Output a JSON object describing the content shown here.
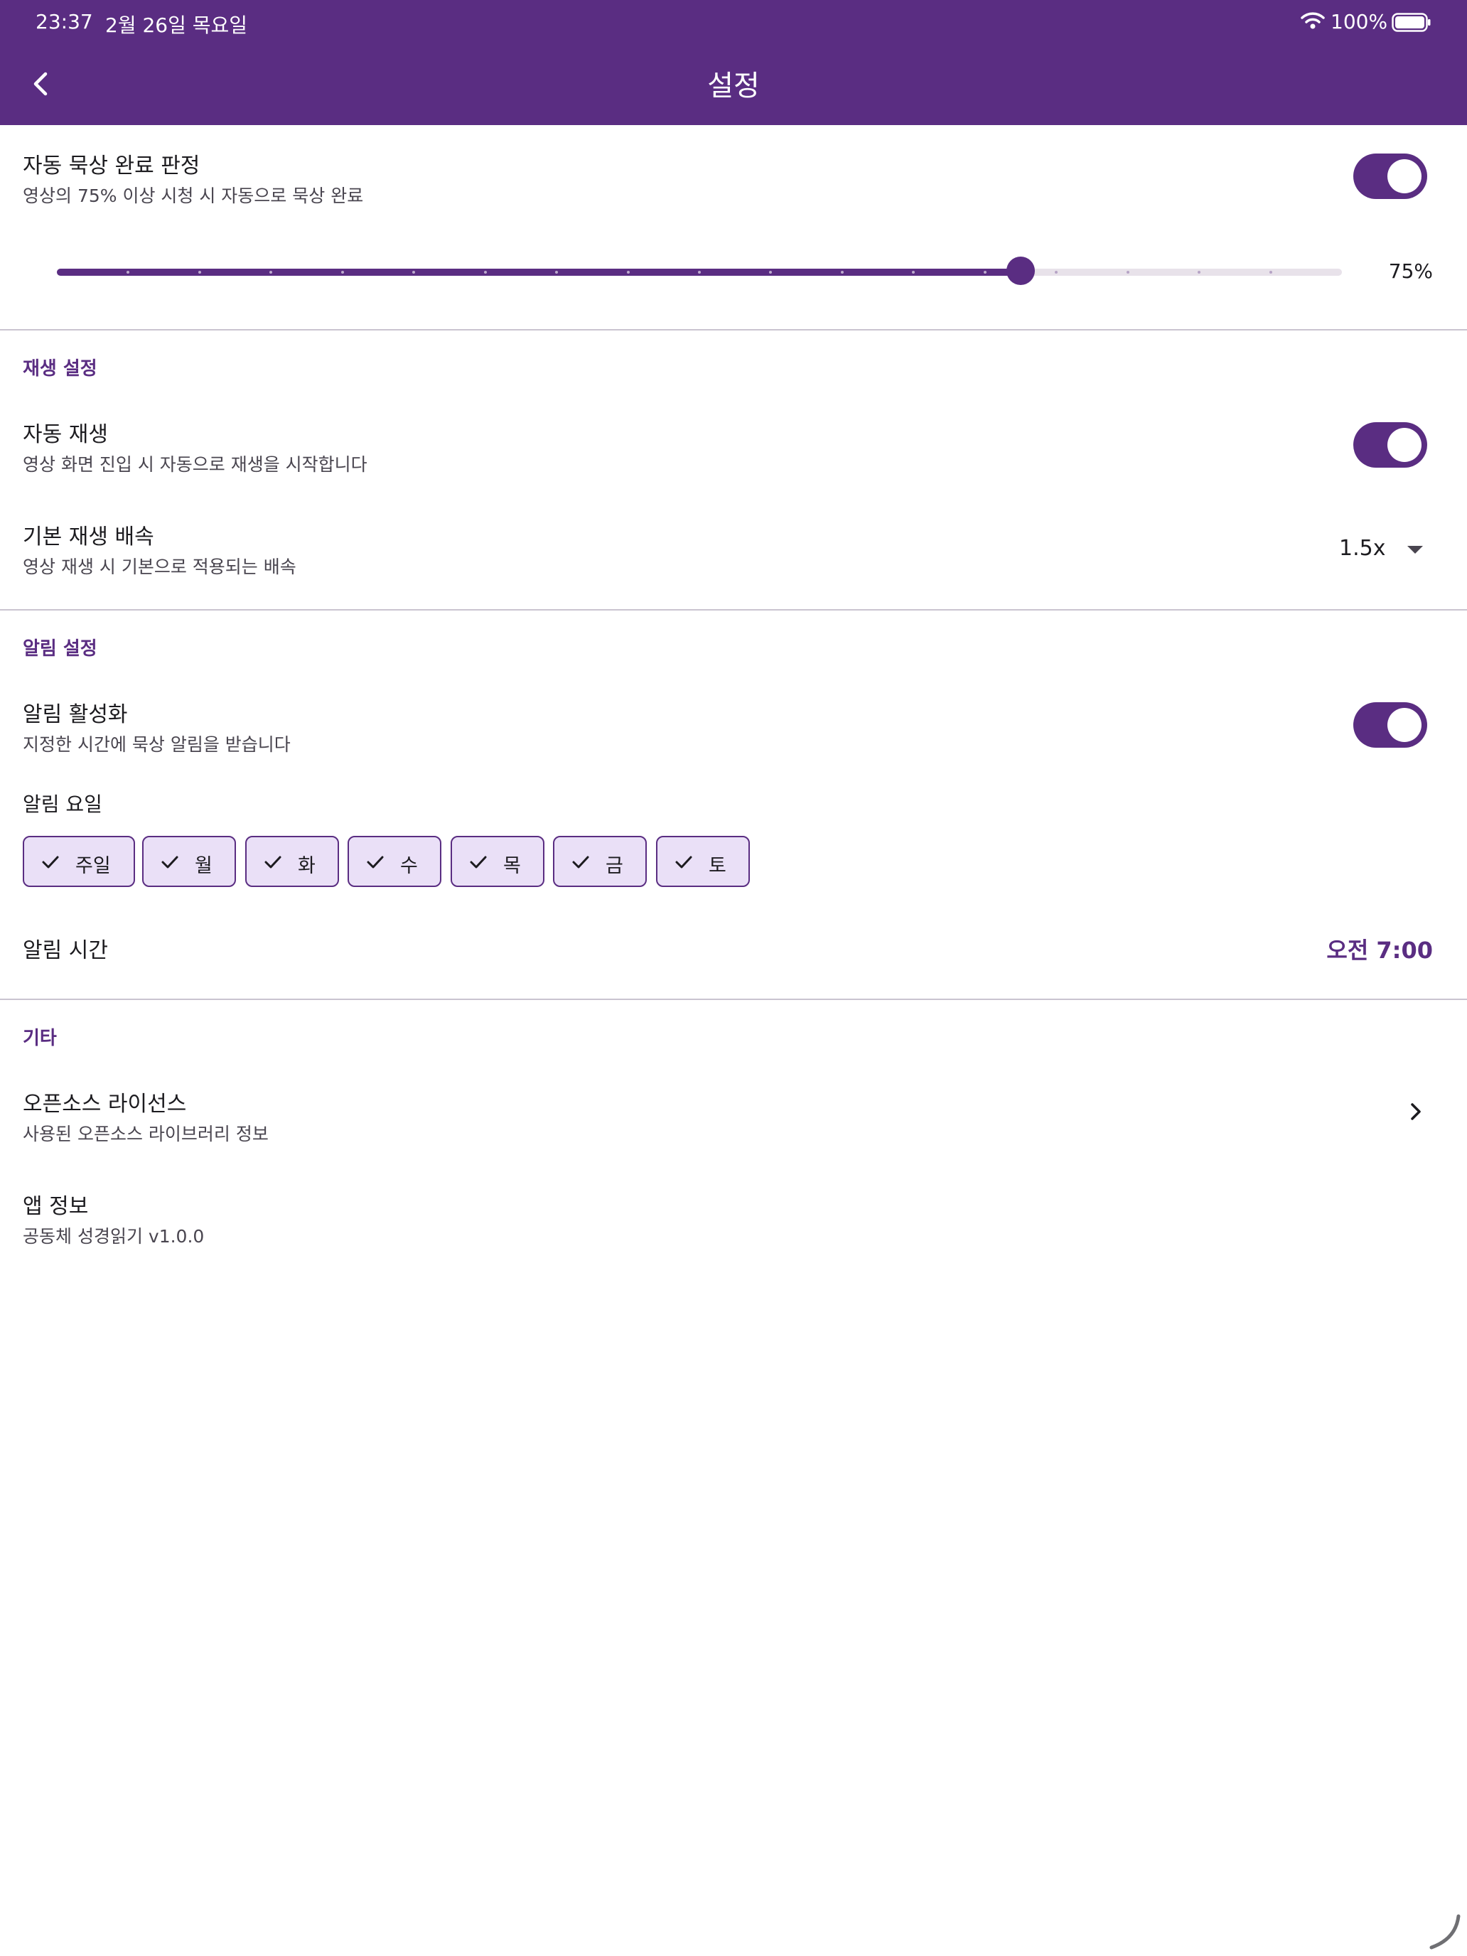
{
  "status_bar": {
    "time": "23:37",
    "date": "2월 26일 목요일",
    "battery": "100%"
  },
  "app_bar": {
    "title": "설정"
  },
  "auto_complete": {
    "title": "자동 묵상 완료 판정",
    "subtitle": "영상의 75% 이상 시청 시 자동으로 묵상 완료",
    "enabled": true,
    "slider_value_label": "75%",
    "slider_fraction": 0.75
  },
  "playback": {
    "section_label": "재생 설정",
    "autoplay_title": "자동 재생",
    "autoplay_subtitle": "영상 화면 진입 시 자동으로 재생을 시작합니다",
    "autoplay_enabled": true,
    "speed_title": "기본 재생 배속",
    "speed_subtitle": "영상 재생 시 기본으로 적용되는 배속",
    "speed_value": "1.5x"
  },
  "notification": {
    "section_label": "알림 설정",
    "enable_title": "알림 활성화",
    "enable_subtitle": "지정한 시간에 묵상 알림을 받습니다",
    "enabled": true,
    "days_label": "알림 요일",
    "days": [
      "주일",
      "월",
      "화",
      "수",
      "목",
      "금",
      "토"
    ],
    "time_label": "알림 시간",
    "time_value": "오전 7:00"
  },
  "etc": {
    "section_label": "기타",
    "license_title": "오픈소스 라이선스",
    "license_subtitle": "사용된 오픈소스 라이브러리 정보",
    "app_info_title": "앱 정보",
    "app_info_subtitle": "공동체 성경읽기 v1.0.0"
  },
  "colors": {
    "primary": "#5a2d82",
    "chip_bg": "#eae0f7",
    "divider": "#cac4d0"
  }
}
